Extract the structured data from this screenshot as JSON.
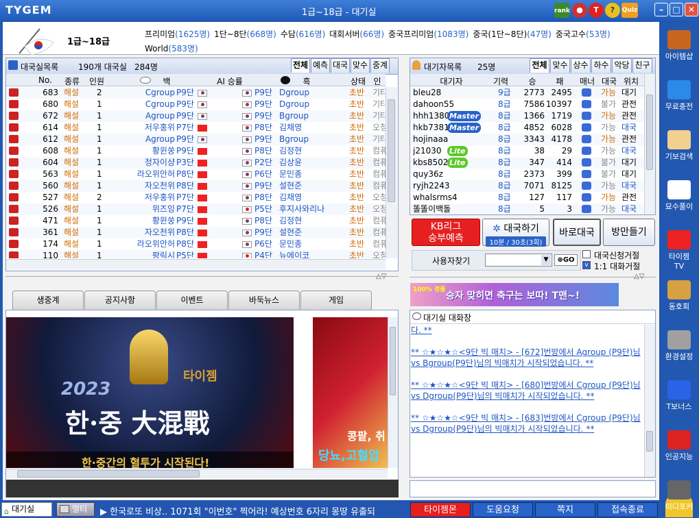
{
  "titlebar": {
    "logo": "TYGEM",
    "title": "1급~18급 - 대기실",
    "icons": [
      "rank-icon",
      "bowling-icon",
      "t-icon",
      "bulb-icon",
      "quiz-icon"
    ],
    "icon_labels": {
      "rank": "rank",
      "quiz": "Quiz",
      "t": "T"
    }
  },
  "header": {
    "room_title": "1급~18급",
    "servers": [
      {
        "name": "프리미엄",
        "count": "(1625명)"
      },
      {
        "name": "1단~8단",
        "count": "(668명)"
      },
      {
        "name": "수담",
        "count": "(616명)"
      },
      {
        "name": "대회서버",
        "count": "(66명)"
      },
      {
        "name": "중국프리미엄",
        "count": "(1083명)"
      },
      {
        "name": "중국(1단~8단)",
        "count": "(47명)"
      },
      {
        "name": "중국고수",
        "count": "(53명)"
      },
      {
        "name": "World",
        "count": "(583명)"
      }
    ]
  },
  "game_list": {
    "title": "대국실목록",
    "room_count": "190개 대국실",
    "player_count": "284명",
    "tabs": [
      "전체",
      "예측",
      "대국",
      "맞수",
      "중계"
    ],
    "columns": [
      "No.",
      "종류",
      "인원",
      "백",
      "AI 승률",
      "흑",
      "상태",
      "인원"
    ],
    "white_label": "백",
    "black_label": "흑",
    "rows": [
      {
        "no": "683",
        "type": "해설",
        "people": "2",
        "white": "Cgroup",
        "wrank": "P9단",
        "wflag": "kr",
        "brank": "P9단",
        "black": "Dgroup",
        "bflag": "kr",
        "status": "초반",
        "extra": "기타"
      },
      {
        "no": "680",
        "type": "해설",
        "people": "1",
        "white": "Cgroup",
        "wrank": "P9단",
        "wflag": "kr",
        "brank": "P9단",
        "black": "Dgroup",
        "bflag": "kr",
        "status": "초반",
        "extra": "기타"
      },
      {
        "no": "672",
        "type": "해설",
        "people": "1",
        "white": "Agroup",
        "wrank": "P9단",
        "wflag": "kr",
        "brank": "P9단",
        "black": "Bgroup",
        "bflag": "kr",
        "status": "초반",
        "extra": "기타"
      },
      {
        "no": "614",
        "type": "해설",
        "people": "1",
        "white": "저우홍위",
        "wrank": "P7단",
        "wflag": "cn",
        "brank": "P8단",
        "black": "김채영",
        "bflag": "kr",
        "status": "초반",
        "extra": "오청"
      },
      {
        "no": "612",
        "type": "해설",
        "people": "1",
        "white": "Agroup",
        "wrank": "P9단",
        "wflag": "kr",
        "brank": "P9단",
        "black": "Bgroup",
        "bflag": "kr",
        "status": "초반",
        "extra": "기타"
      },
      {
        "no": "608",
        "type": "해설",
        "people": "1",
        "white": "황윈쑹",
        "wrank": "P9단",
        "wflag": "cn",
        "brank": "P8단",
        "black": "김정현",
        "bflag": "kr",
        "status": "초반",
        "extra": "컴퓨"
      },
      {
        "no": "604",
        "type": "해설",
        "people": "1",
        "white": "정자이샹",
        "wrank": "P3단",
        "wflag": "cn",
        "brank": "P2단",
        "black": "김상윤",
        "bflag": "kr",
        "status": "초반",
        "extra": "컴퓨"
      },
      {
        "no": "563",
        "type": "해설",
        "people": "1",
        "white": "라오위안허",
        "wrank": "P8단",
        "wflag": "cn",
        "brank": "P6단",
        "black": "문민종",
        "bflag": "kr",
        "status": "초반",
        "extra": "컴퓨"
      },
      {
        "no": "560",
        "type": "해설",
        "people": "1",
        "white": "자오천위",
        "wrank": "P8단",
        "wflag": "cn",
        "brank": "P9단",
        "black": "설현준",
        "bflag": "kr",
        "status": "초반",
        "extra": "컴퓨"
      },
      {
        "no": "527",
        "type": "해설",
        "people": "2",
        "white": "저우홍위",
        "wrank": "P7단",
        "wflag": "cn",
        "brank": "P8단",
        "black": "김채영",
        "bflag": "kr",
        "status": "초반",
        "extra": "오청"
      },
      {
        "no": "526",
        "type": "해설",
        "people": "1",
        "white": "위즈잉",
        "wrank": "P7단",
        "wflag": "cn",
        "brank": "P5단",
        "black": "후지사와리나",
        "bflag": "jp",
        "status": "초반",
        "extra": "오청"
      },
      {
        "no": "471",
        "type": "해설",
        "people": "1",
        "white": "황윈쑹",
        "wrank": "P9단",
        "wflag": "cn",
        "brank": "P8단",
        "black": "김정현",
        "bflag": "kr",
        "status": "초반",
        "extra": "컴퓨"
      },
      {
        "no": "361",
        "type": "해설",
        "people": "1",
        "white": "자오천위",
        "wrank": "P8단",
        "wflag": "cn",
        "brank": "P9단",
        "black": "설현준",
        "bflag": "kr",
        "status": "초반",
        "extra": "컴퓨"
      },
      {
        "no": "174",
        "type": "해설",
        "people": "1",
        "white": "라오위안허",
        "wrank": "P8단",
        "wflag": "cn",
        "brank": "P6단",
        "black": "문민종",
        "bflag": "kr",
        "status": "초반",
        "extra": "컴퓨"
      },
      {
        "no": "110",
        "type": "해설",
        "people": "1",
        "white": "팡릭시",
        "wrank": "P5단",
        "wflag": "cn",
        "brank": "P4단",
        "black": "뉴에이코",
        "bflag": "jp",
        "status": "초반",
        "extra": "오청"
      }
    ]
  },
  "waiting_list": {
    "title": "대기자목록",
    "count": "25명",
    "tabs": [
      "전체",
      "맞수",
      "상수",
      "하수",
      "악당",
      "친구"
    ],
    "columns": [
      "대기자",
      "기력",
      "승",
      "패",
      "매너",
      "대국",
      "위치"
    ],
    "rows": [
      {
        "name": "bleu28",
        "badge": "",
        "rank": "9급",
        "win": "2773",
        "loss": "2495",
        "avail": "가능",
        "loc": "대기",
        "availcls": "orange"
      },
      {
        "name": "dahoon55",
        "badge": "",
        "rank": "8급",
        "win": "7586",
        "loss": "10397",
        "avail": "불가",
        "loc": "관전",
        "availcls": "gray"
      },
      {
        "name": "hhh1380",
        "badge": "Master",
        "rank": "8급",
        "win": "1366",
        "loss": "1719",
        "avail": "가능",
        "loc": "관전",
        "availcls": "orange"
      },
      {
        "name": "hkb7381",
        "badge": "Master",
        "rank": "8급",
        "win": "4852",
        "loss": "6028",
        "avail": "가능",
        "loc": "대국",
        "availcls": "gray"
      },
      {
        "name": "hojinaaa",
        "badge": "",
        "rank": "8급",
        "win": "3343",
        "loss": "4178",
        "avail": "가능",
        "loc": "관전",
        "availcls": "orange"
      },
      {
        "name": "j21030",
        "badge": "Lite",
        "rank": "8급",
        "win": "38",
        "loss": "29",
        "avail": "가능",
        "loc": "대국",
        "availcls": "gray"
      },
      {
        "name": "kbs8502",
        "badge": "Lite",
        "rank": "8급",
        "win": "347",
        "loss": "414",
        "avail": "불가",
        "loc": "대기",
        "availcls": "gray"
      },
      {
        "name": "quy36z",
        "badge": "",
        "rank": "8급",
        "win": "2373",
        "loss": "399",
        "avail": "불가",
        "loc": "대기",
        "availcls": "gray"
      },
      {
        "name": "ryjh2243",
        "badge": "",
        "rank": "8급",
        "win": "7071",
        "loss": "8125",
        "avail": "가능",
        "loc": "대국",
        "availcls": "gray"
      },
      {
        "name": "whalsrms4",
        "badge": "",
        "rank": "8급",
        "win": "127",
        "loss": "117",
        "avail": "가능",
        "loc": "관전",
        "availcls": "orange"
      },
      {
        "name": "똘똘이백돌",
        "badge": "",
        "rank": "8급",
        "win": "5",
        "loss": "3",
        "avail": "가능",
        "loc": "대국",
        "availcls": "gray"
      }
    ]
  },
  "actions": {
    "kb_line1": "KB리그",
    "kb_line2": "승부예측",
    "challenge": "대국하기",
    "challenge_sub": "10분 / 30초(3회)",
    "quick": "바로대국",
    "room": "방만들기",
    "user_search": "사용자찾기",
    "go": "GO",
    "opt1": "대국신청거절",
    "opt2": "1:1 대화거절"
  },
  "banner": {
    "text": "승자 맞히면 축구는 보따! T맨~!",
    "text2": "100% 경품"
  },
  "chat": {
    "title": "대기실 대화창",
    "lines": [
      "다. **",
      "** ☆★☆★☆<9단 빅 매치> - [672]번방에서 Agroup (P9단)님 vs Bgroup(P9단)님의 빅매치가 시작되었습니다. **",
      "** ☆★☆★☆<9단 빅 매치> - [680]번방에서 Cgroup (P9단)님 vs Dgroup(P9단)님의 빅매치가 시작되었습니다. **",
      "** ☆★☆★☆<9단 빅 매치> - [683]번방에서 Cgroup (P9단)님 vs Dgroup(P9단)님의 빅매치가 시작되었습니다. **"
    ]
  },
  "news": {
    "tabs": [
      "생중계",
      "공지사항",
      "이벤트",
      "바둑뉴스",
      "게임"
    ],
    "banner1_title": "한·중 大混戰",
    "banner1_sub": "한·중간의 혈투가 시작된다!",
    "banner1_year": "2023",
    "banner1_brand": "타이젬",
    "banner2_title1": "콩팥, 취",
    "banner2_title2": "당뇨,고혈압"
  },
  "taskbar": {
    "waiting": "대기실",
    "multi": "멀티",
    "ticker": "▶ 한국로또 비상.. 1071회 \"이번호\" 찍어라! 예상번호 6자리 몽땅 유출되",
    "btns": [
      "타이젬몬",
      "도움요청",
      "쪽지",
      "접속종료"
    ]
  },
  "sidebar": [
    "아이템샵",
    "무료충전",
    "기보검색",
    "묘수풀이",
    "타이젬TV",
    "동호회",
    "환경설정",
    "T보너스",
    "인공지능",
    "미디포커"
  ]
}
